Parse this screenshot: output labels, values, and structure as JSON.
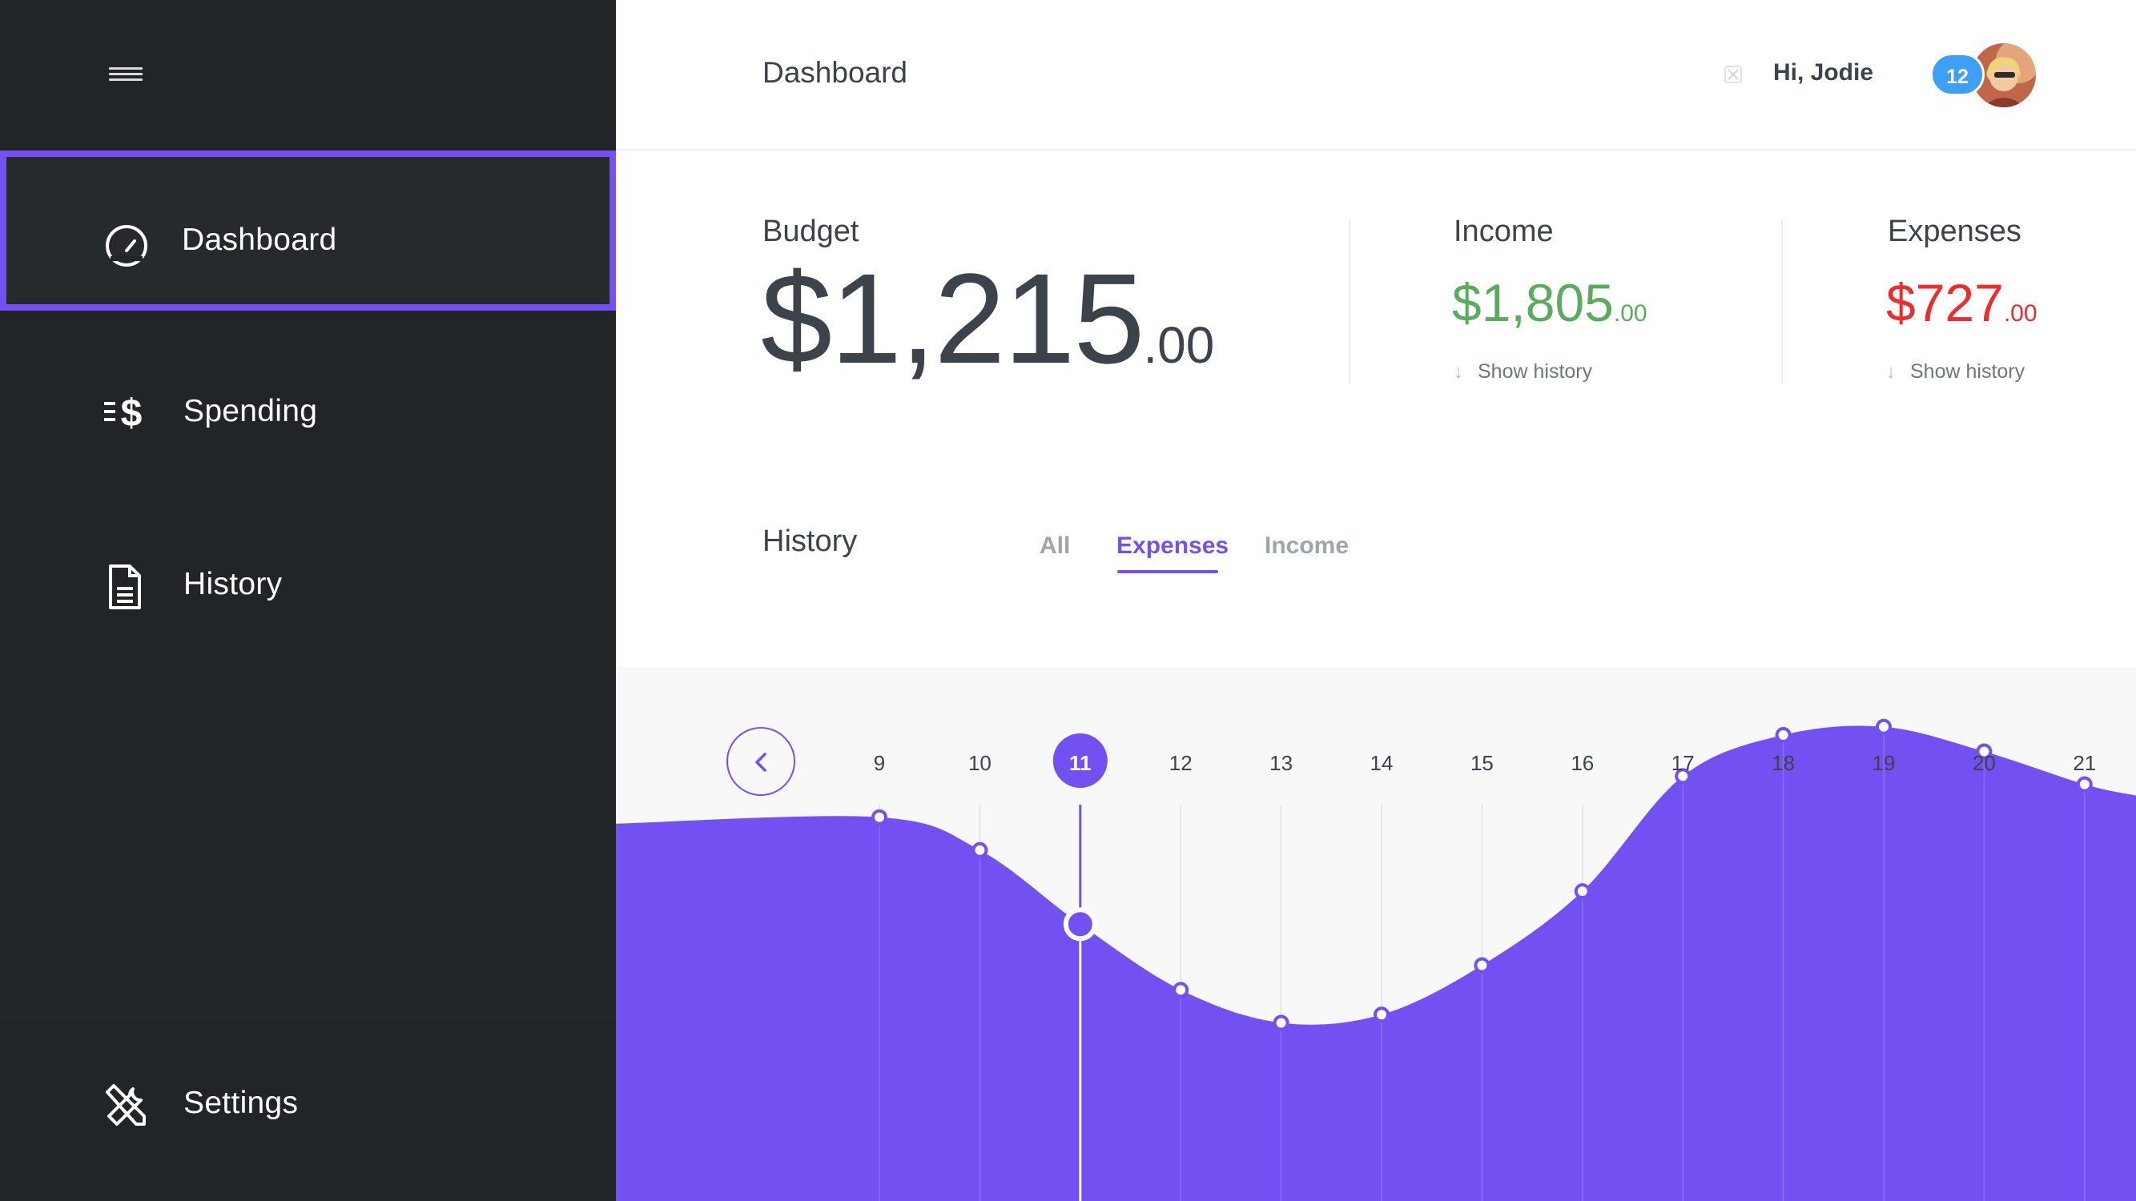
{
  "sidebar": {
    "menu_icon": "hamburger-icon",
    "items": [
      {
        "label": "Dashboard",
        "icon": "speedometer-icon",
        "active": true
      },
      {
        "label": "Spending",
        "icon": "dollar-speed-icon",
        "active": false
      },
      {
        "label": "History",
        "icon": "document-icon",
        "active": false
      },
      {
        "label": "Settings",
        "icon": "tools-icon",
        "active": false
      }
    ]
  },
  "header": {
    "title": "Dashboard",
    "greeting": "Hi, Jodie",
    "notification_count": "12"
  },
  "stats": {
    "budget": {
      "label": "Budget",
      "whole": "$1,215",
      "cents": ".00"
    },
    "income": {
      "label": "Income",
      "whole": "$1,805",
      "cents": ".00",
      "link": "Show history",
      "color": "#5bab5e"
    },
    "expenses": {
      "label": "Expenses",
      "whole": "$727",
      "cents": ".00",
      "link": "Show history",
      "color": "#ec2d2d"
    }
  },
  "history": {
    "title": "History",
    "tabs": [
      {
        "label": "All",
        "active": false
      },
      {
        "label": "Expenses",
        "active": true
      },
      {
        "label": "Income",
        "active": false
      }
    ]
  },
  "colors": {
    "accent": "#7350f2",
    "sidebar_bg": "#222527",
    "badge": "#3d9ff6"
  },
  "chart_data": {
    "type": "area",
    "x": [
      "9",
      "10",
      "11",
      "12",
      "13",
      "14",
      "15",
      "16",
      "17",
      "18",
      "19",
      "20",
      "21"
    ],
    "selected": "11",
    "values": [
      64,
      60,
      51,
      43,
      39,
      40,
      46,
      55,
      69,
      74,
      75,
      72,
      68
    ],
    "ylim": [
      0,
      100
    ],
    "color": "#7350f2"
  }
}
